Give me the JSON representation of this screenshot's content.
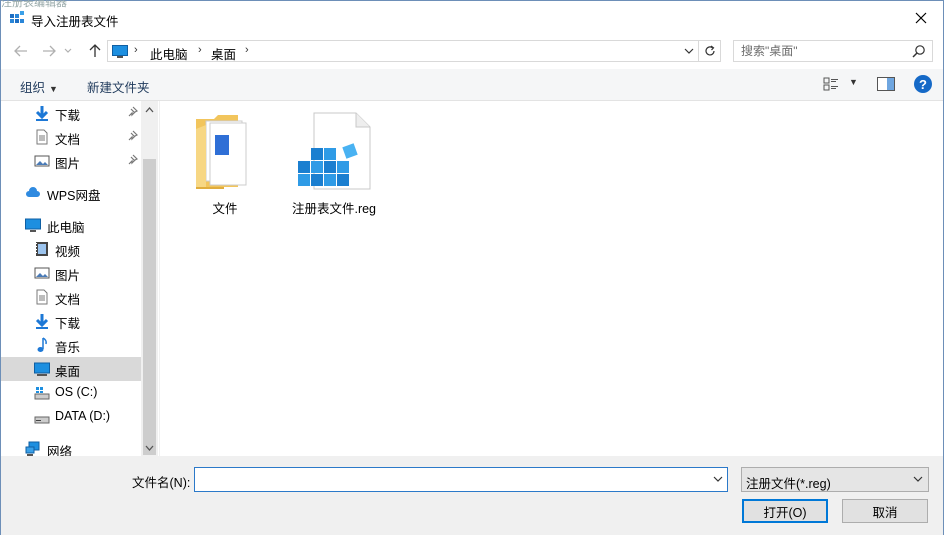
{
  "window": {
    "title": "导入注册表文件",
    "ghost_title": "注册表编辑器"
  },
  "nav": {
    "breadcrumb": [
      "此电脑",
      "桌面"
    ],
    "search_placeholder": "搜索\"桌面\""
  },
  "toolbar": {
    "organize": "组织",
    "new_folder": "新建文件夹",
    "help": "?"
  },
  "sidebar": {
    "items": [
      {
        "label": "下载",
        "icon": "download-icon",
        "pinned": true
      },
      {
        "label": "文档",
        "icon": "document-icon",
        "pinned": true
      },
      {
        "label": "图片",
        "icon": "picture-icon",
        "pinned": true
      },
      {
        "label": "WPS网盘",
        "icon": "cloud-icon",
        "pinned": false
      },
      {
        "label": "此电脑",
        "icon": "computer-icon",
        "pinned": false
      },
      {
        "label": "视频",
        "icon": "video-icon",
        "pinned": false
      },
      {
        "label": "图片",
        "icon": "picture-icon",
        "pinned": false
      },
      {
        "label": "文档",
        "icon": "document-icon",
        "pinned": false
      },
      {
        "label": "下载",
        "icon": "download-icon",
        "pinned": false
      },
      {
        "label": "音乐",
        "icon": "music-icon",
        "pinned": false
      },
      {
        "label": "桌面",
        "icon": "desktop-icon",
        "pinned": false,
        "selected": true
      },
      {
        "label": "OS (C:)",
        "icon": "windows-drive-icon",
        "pinned": false
      },
      {
        "label": "DATA (D:)",
        "icon": "drive-icon",
        "pinned": false
      },
      {
        "label": "网络",
        "icon": "network-icon",
        "pinned": false
      }
    ]
  },
  "files": [
    {
      "name": "文件",
      "icon": "folder-icon"
    },
    {
      "name": "注册表文件.reg",
      "icon": "registry-file-icon"
    }
  ],
  "bottom": {
    "filename_label": "文件名(N):",
    "filename_value": "",
    "filetype": "注册文件(*.reg)",
    "open": "打开(O)",
    "cancel": "取消"
  },
  "colors": {
    "accent": "#0078d7",
    "selected_bg": "#d9d9d9",
    "help": "#1569c7"
  }
}
